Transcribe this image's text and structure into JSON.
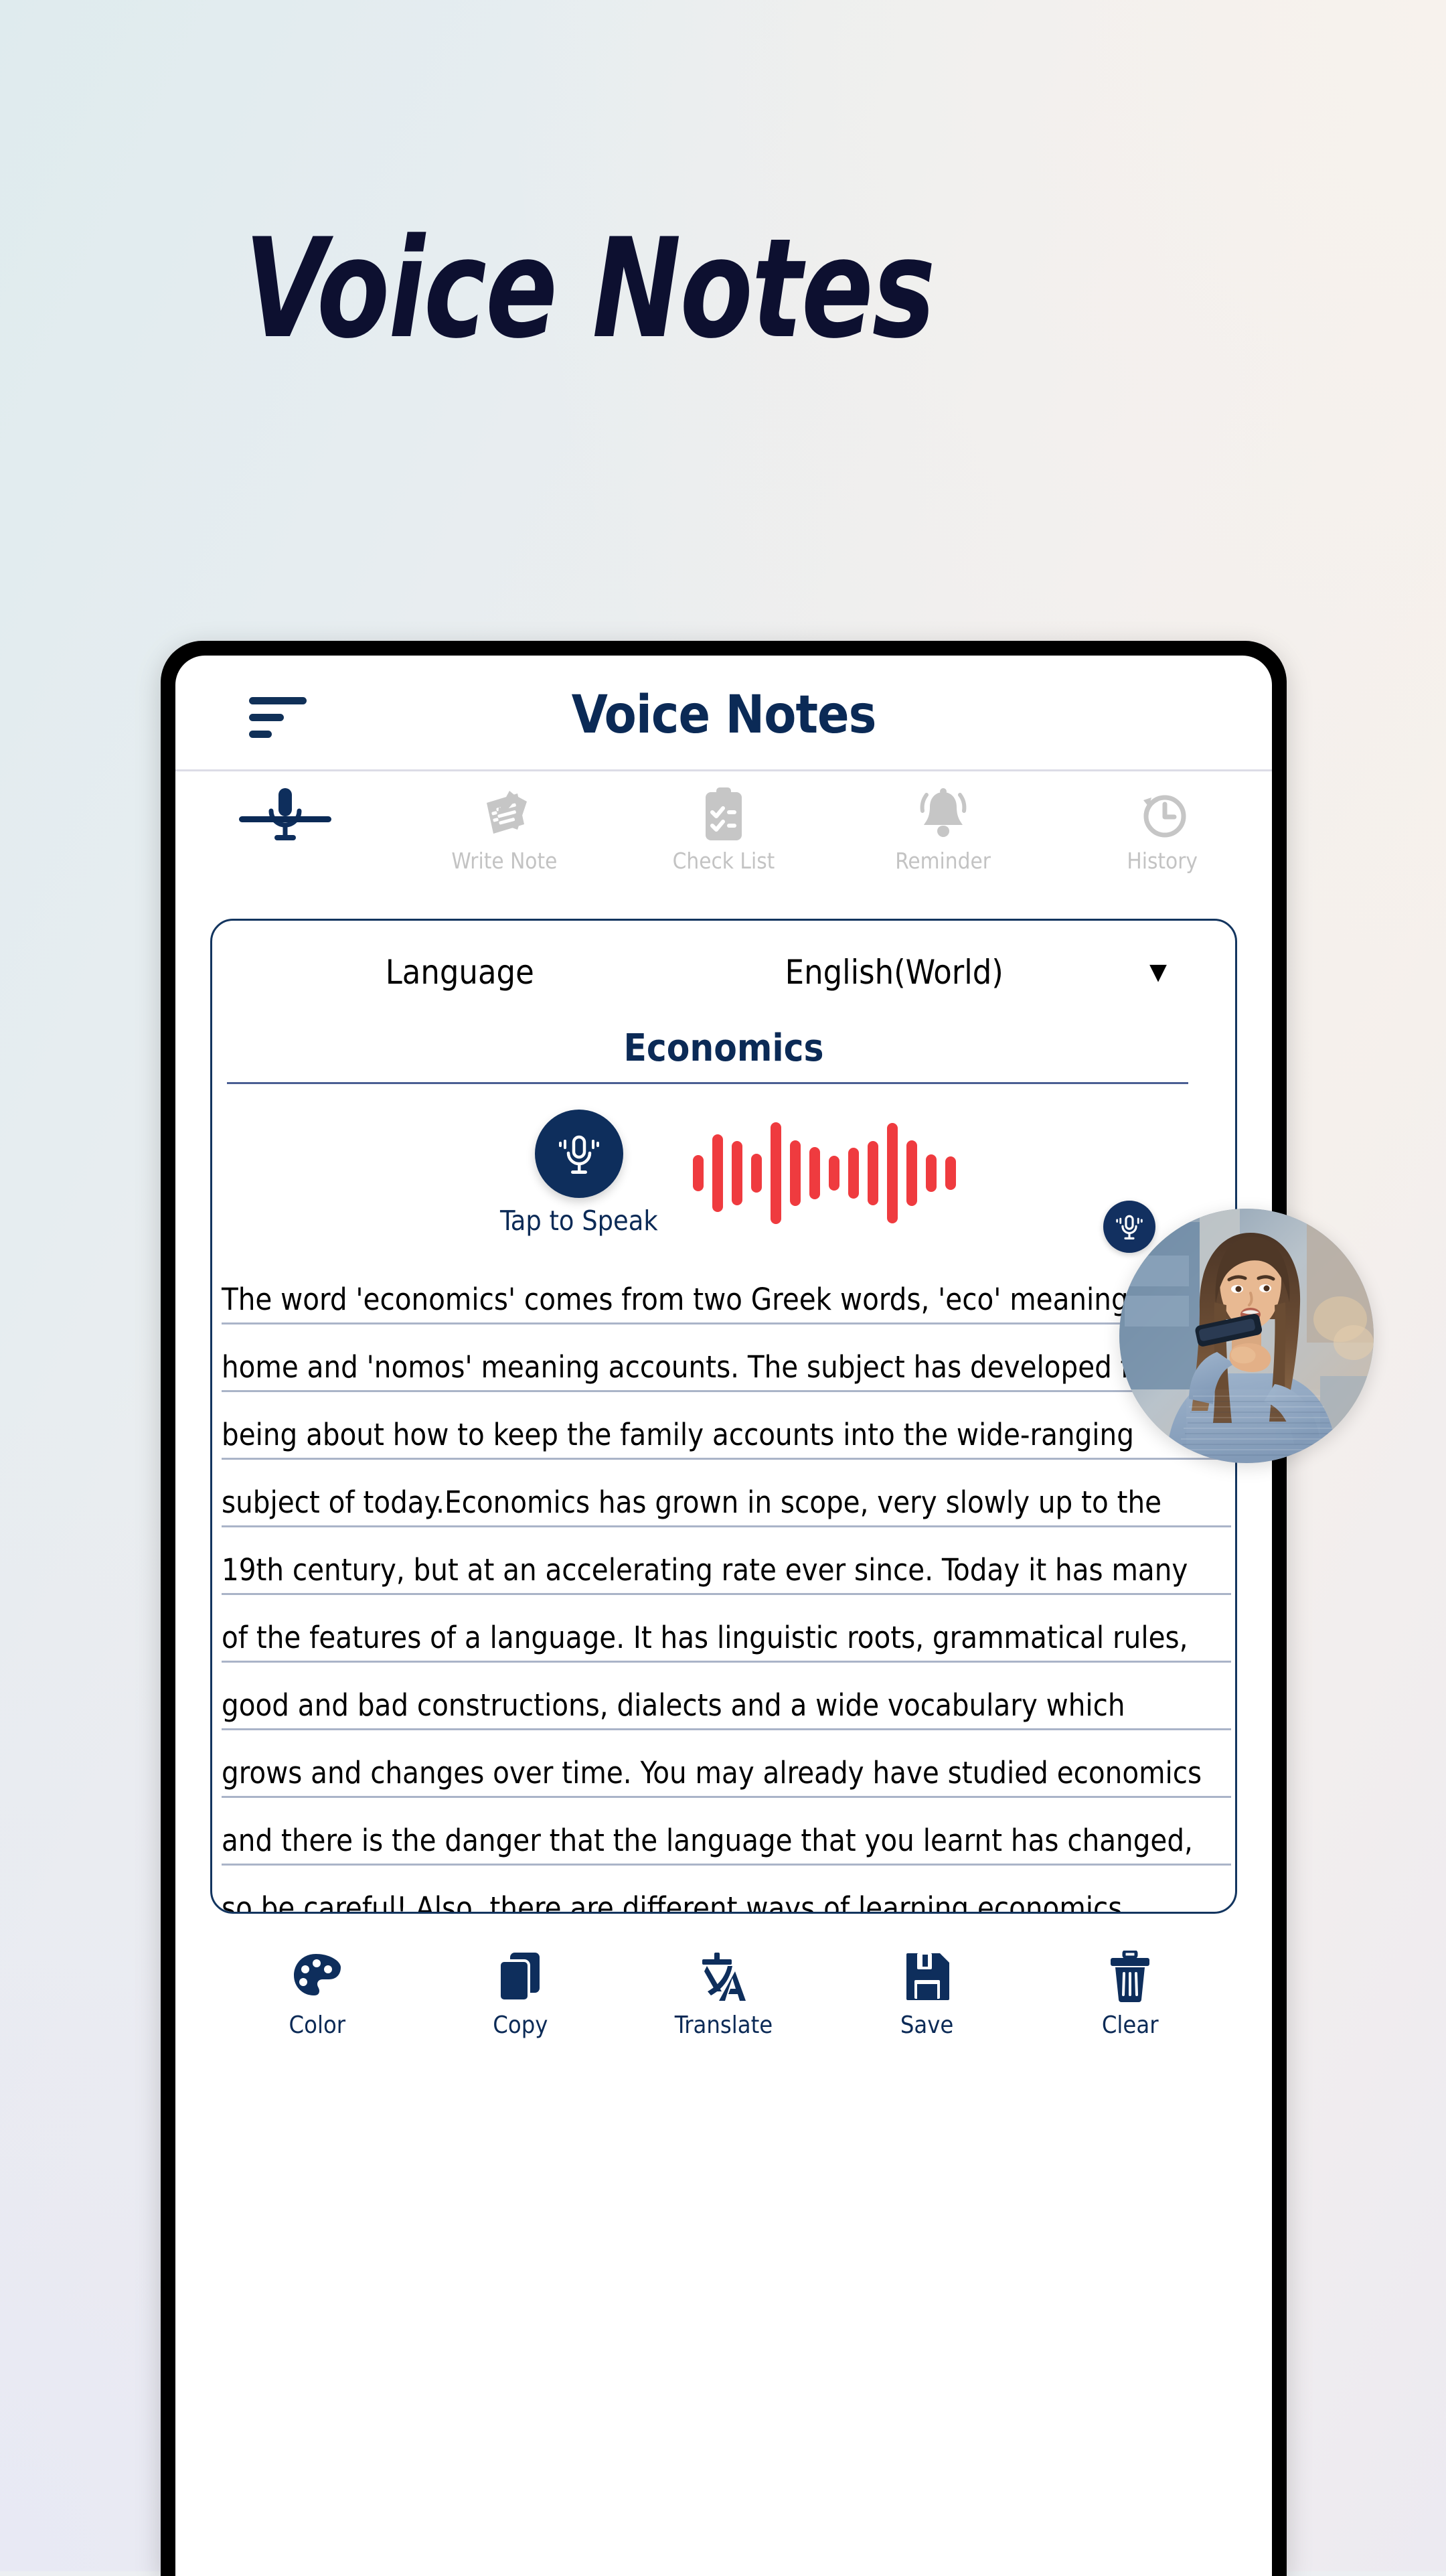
{
  "hero": {
    "title": "Voice Notes"
  },
  "colors": {
    "navy": "#0b2a56",
    "navy_dark": "#0d1030",
    "wave_red": "#ef3b3f",
    "tab_gray": "#c3c3c3",
    "bg_teal": "#dfebee",
    "bg_warm": "#f5f0ec",
    "bg_lavender": "#e8e9f4"
  },
  "app": {
    "title": "Voice Notes",
    "menu_icon": "hamburger-icon"
  },
  "tabs": [
    {
      "label": "",
      "icon": "microphone-icon",
      "active": true
    },
    {
      "label": "Write Note",
      "icon": "write-note-icon",
      "active": false
    },
    {
      "label": "Check List",
      "icon": "checklist-icon",
      "active": false
    },
    {
      "label": "Reminder",
      "icon": "bell-icon",
      "active": false
    },
    {
      "label": "History",
      "icon": "clock-history-icon",
      "active": false
    }
  ],
  "card": {
    "language_label": "Language",
    "language_value": "English(World)",
    "caret": "▼",
    "note_title": "Economics",
    "speak_label": "Tap to Speak",
    "mic_icon": "microphone-icon",
    "waveform": {
      "color": "#ef3b3f",
      "bars": [
        54,
        116,
        96,
        58,
        152,
        98,
        78,
        52,
        76,
        96,
        150,
        98,
        56,
        50
      ]
    },
    "note_lines": [
      "The word 'economics' comes from two Greek words, 'eco' meaning",
      "home and 'nomos' meaning accounts. The subject has developed from",
      "being about how to keep the family accounts into the wide-ranging",
      "subject of today.Economics has grown in scope, very slowly up to the",
      "19th century, but at an accelerating rate ever since. Today it has many",
      "of the features of a language. It has linguistic roots, grammatical rules,",
      "good and bad constructions, dialects and a wide vocabulary which",
      "grows and changes over time. You may already have studied economics",
      "and there is the danger that the language that you learnt has changed,",
      "so be careful! Also, there are different ways of learning economics."
    ]
  },
  "toolbar": [
    {
      "label": "Color",
      "icon": "palette-icon"
    },
    {
      "label": "Copy",
      "icon": "copy-icon"
    },
    {
      "label": "Translate",
      "icon": "translate-icon"
    },
    {
      "label": "Save",
      "icon": "save-floppy-icon"
    },
    {
      "label": "Clear",
      "icon": "trash-icon"
    }
  ],
  "photo": {
    "alt": "woman-speaking-into-phone",
    "badge_icon": "microphone-icon"
  }
}
